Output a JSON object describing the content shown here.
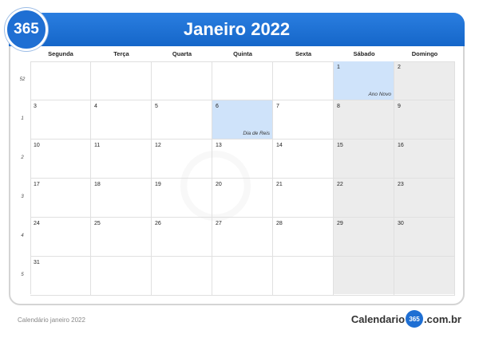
{
  "header": {
    "logo_text": "365",
    "title": "Janeiro 2022"
  },
  "weekdays": [
    "Segunda",
    "Terça",
    "Quarta",
    "Quinta",
    "Sexta",
    "Sábado",
    "Domingo"
  ],
  "weeks": [
    {
      "number": "52",
      "days": [
        "",
        "",
        "",
        "",
        "",
        "1",
        "2"
      ]
    },
    {
      "number": "1",
      "days": [
        "3",
        "4",
        "5",
        "6",
        "7",
        "8",
        "9"
      ]
    },
    {
      "number": "2",
      "days": [
        "10",
        "11",
        "12",
        "13",
        "14",
        "15",
        "16"
      ]
    },
    {
      "number": "3",
      "days": [
        "17",
        "18",
        "19",
        "20",
        "21",
        "22",
        "23"
      ]
    },
    {
      "number": "4",
      "days": [
        "24",
        "25",
        "26",
        "27",
        "28",
        "29",
        "30"
      ]
    },
    {
      "number": "5",
      "days": [
        "31",
        "",
        "",
        "",
        "",
        "",
        ""
      ]
    }
  ],
  "holidays": {
    "ano_novo": "Ano Novo",
    "dia_de_reis": "Dia de Reis"
  },
  "footer": {
    "caption": "Calendário janeiro 2022",
    "brand_prefix": "Calendario",
    "brand_circle": "365",
    "brand_suffix": ".com.br"
  },
  "colors": {
    "header_blue": "#1f6fd3",
    "highlight": "#cfe3fa",
    "weekend": "#ececec"
  }
}
